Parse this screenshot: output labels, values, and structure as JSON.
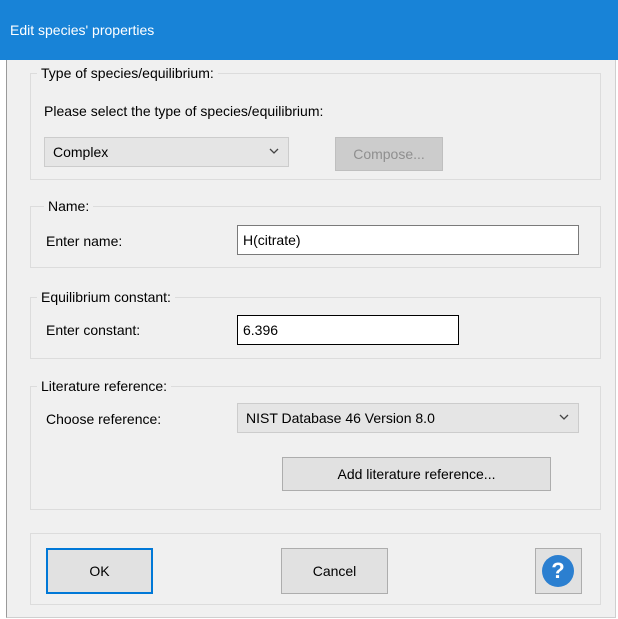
{
  "window": {
    "title": "Edit species' properties"
  },
  "type_group": {
    "legend": "Type of species/equilibrium:",
    "prompt": "Please select the type of species/equilibrium:",
    "combo_value": "Complex",
    "compose_label": "Compose..."
  },
  "name_group": {
    "legend": "Name:",
    "label": "Enter name:",
    "value": "H(citrate)"
  },
  "constant_group": {
    "legend": "Equilibrium constant:",
    "label": "Enter constant:",
    "value": "6.396"
  },
  "reference_group": {
    "legend": "Literature reference:",
    "label": "Choose reference:",
    "combo_value": "NIST Database 46 Version 8.0",
    "add_label": "Add literature reference..."
  },
  "buttons": {
    "ok": "OK",
    "cancel": "Cancel",
    "help": "?"
  },
  "icons": {
    "combo_arrow": "chevron-down-icon",
    "help": "help-icon"
  },
  "colors": {
    "titlebar": "#1883d7",
    "dialog_bg": "#f0f0f0",
    "default_button_border": "#0078d7",
    "help_icon": "#2b7fd0"
  }
}
